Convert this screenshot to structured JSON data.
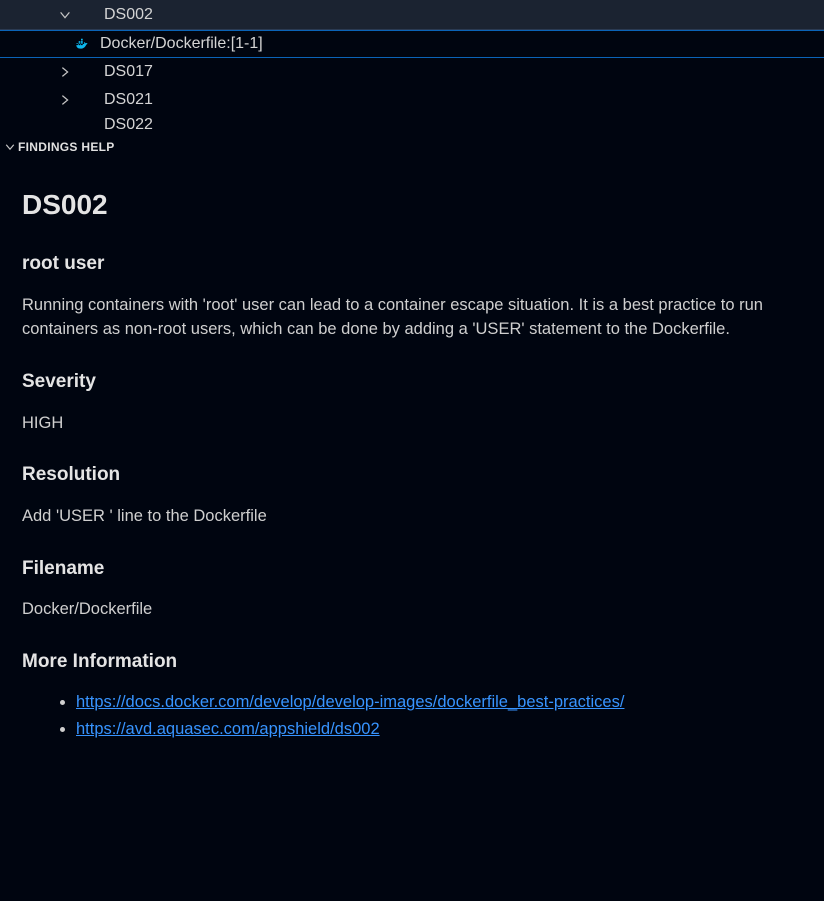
{
  "tree": {
    "rows": [
      {
        "label": "DS002",
        "expanded": true
      },
      {
        "file_label": "Docker/Dockerfile:[1-1]"
      },
      {
        "label": "DS017",
        "expanded": false
      },
      {
        "label": "DS021",
        "expanded": false
      },
      {
        "label": "DS022",
        "expanded": false
      }
    ]
  },
  "section": {
    "title": "FINDINGS HELP"
  },
  "detail": {
    "id": "DS002",
    "title": "root user",
    "description": "Running containers with 'root' user can lead to a container escape situation. It is a best practice to run containers as non-root users, which can be done by adding a 'USER' statement to the Dockerfile.",
    "severity_heading": "Severity",
    "severity": "HIGH",
    "resolution_heading": "Resolution",
    "resolution": "Add 'USER ' line to the Dockerfile",
    "filename_heading": "Filename",
    "filename": "Docker/Dockerfile",
    "more_heading": "More Information",
    "links": [
      "https://docs.docker.com/develop/develop-images/dockerfile_best-practices/",
      "https://avd.aquasec.com/appshield/ds002"
    ]
  }
}
